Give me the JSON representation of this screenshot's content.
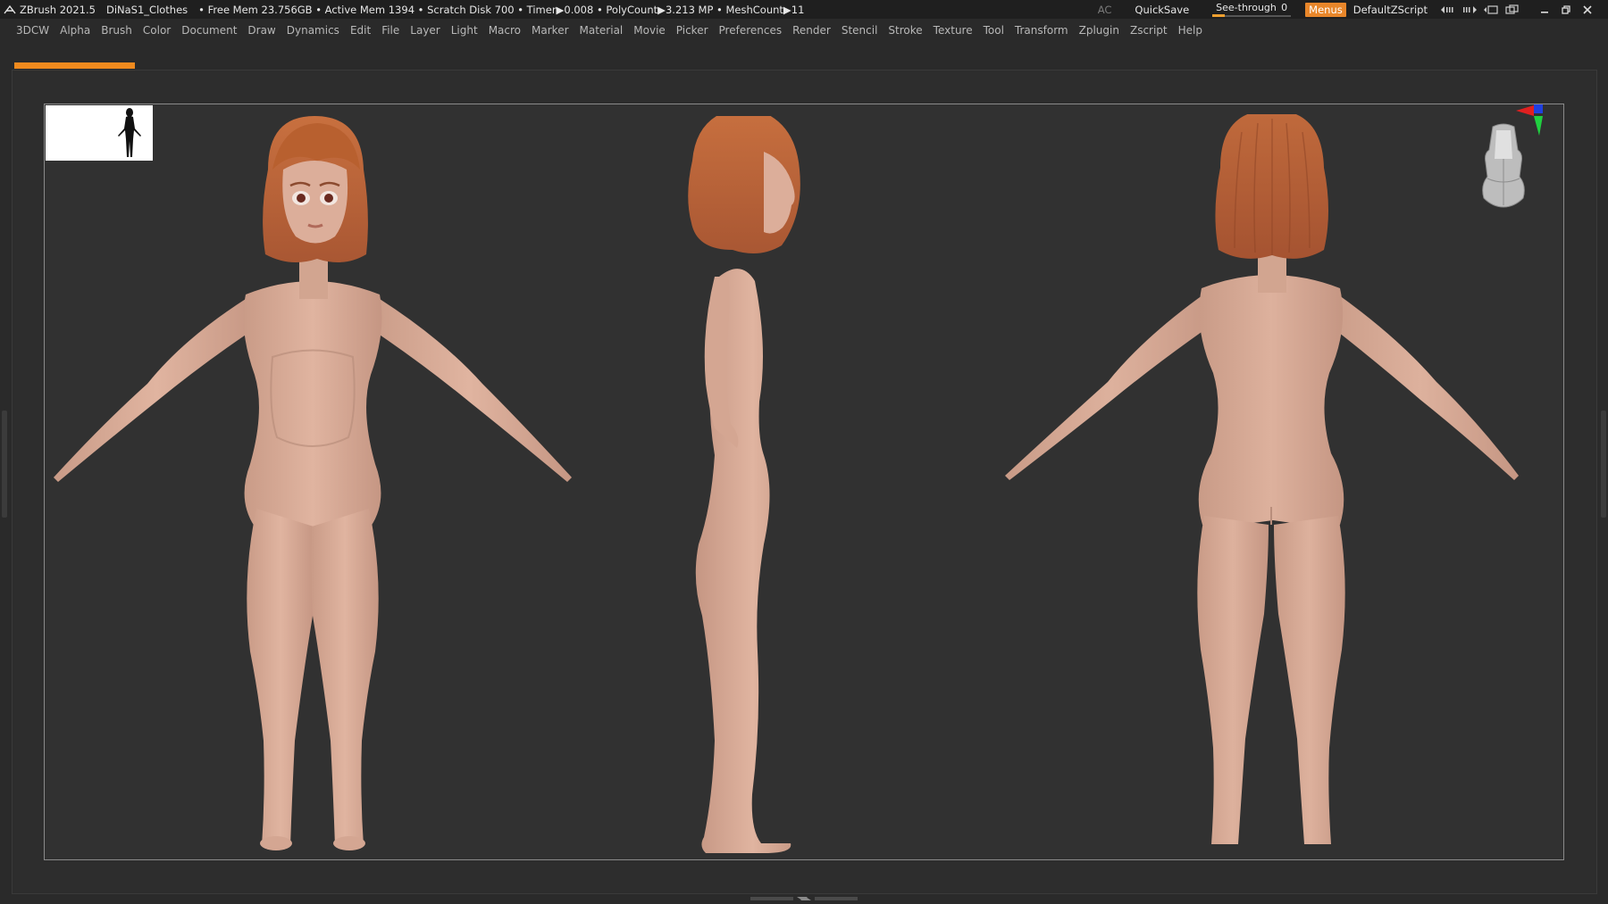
{
  "titlebar": {
    "app": "ZBrush 2021.5",
    "document": "DiNaS1_Clothes",
    "stats": "• Free Mem 23.756GB • Active Mem 1394 • Scratch Disk 700 •  Timer▶0.008 • PolyCount▶3.213 MP  • MeshCount▶11",
    "ac_label": "AC",
    "quicksave_label": "QuickSave",
    "seethrough_label": "See-through",
    "seethrough_value": "0",
    "menus_label": "Menus",
    "zscript_label": "DefaultZScript"
  },
  "menubar": {
    "items": [
      "3DCW",
      "Alpha",
      "Brush",
      "Color",
      "Document",
      "Draw",
      "Dynamics",
      "Edit",
      "File",
      "Layer",
      "Light",
      "Macro",
      "Marker",
      "Material",
      "Movie",
      "Picker",
      "Preferences",
      "Render",
      "Stencil",
      "Stroke",
      "Texture",
      "Tool",
      "Transform",
      "Zplugin",
      "Zscript",
      "Help"
    ]
  },
  "colors": {
    "accent": "#f08a1e",
    "skin": "#d9ab97",
    "skin_shadow": "#b98e7c",
    "hair": "#c86f45",
    "hair_dark": "#9e5233"
  },
  "icons": [
    "zbrush-logo-icon",
    "collapse-left-icon",
    "collapse-right-icon",
    "layout-icon",
    "restore-icon",
    "minimize-icon",
    "maximize-icon",
    "close-icon",
    "gyro-axis-icon",
    "navigator-silhouette-icon"
  ]
}
